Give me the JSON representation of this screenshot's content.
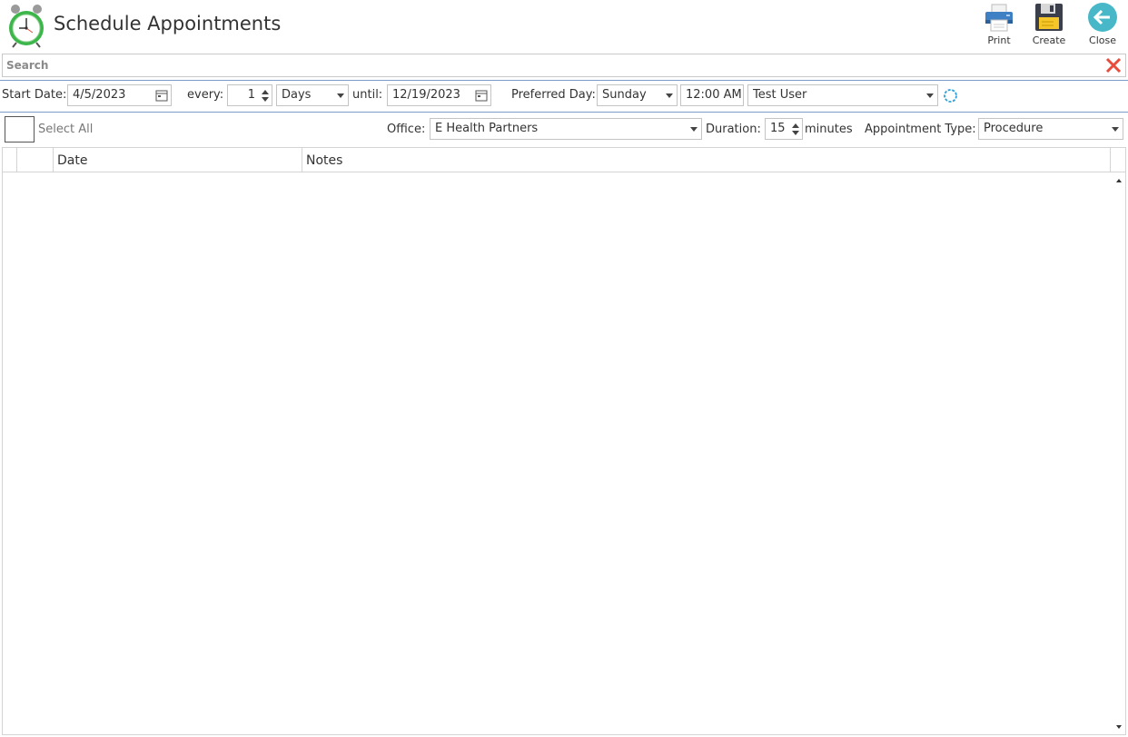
{
  "window": {
    "title": "Schedule Appointments",
    "app_icon": "alarm-clock-icon"
  },
  "toolbar": {
    "print_label": "Print",
    "create_label": "Create",
    "close_label": "Close"
  },
  "search": {
    "placeholder": "Search",
    "value": ""
  },
  "schedule": {
    "start_date_label": "Start Date:",
    "start_date": "4/5/2023",
    "every_label": "every:",
    "every_value": "1",
    "interval_unit": "Days",
    "until_label": "until:",
    "until_date": "12/19/2023",
    "preferred_day_label": "Preferred Day:",
    "preferred_day": "Sunday",
    "time": "12:00 AM",
    "user": "Test User"
  },
  "options": {
    "select_all_label": "Select All",
    "office_label": "Office:",
    "office": "E Health Partners",
    "duration_label": "Duration:",
    "duration_value": "15",
    "duration_unit": "minutes",
    "appointment_type_label": "Appointment Type:",
    "appointment_type": "Procedure"
  },
  "grid": {
    "columns": [
      "",
      "",
      "Date",
      "Notes"
    ],
    "rows": []
  },
  "colors": {
    "accent_rule": "#7b9cc8",
    "close_red": "#e74c3c",
    "refresh_blue": "#2e9fd8",
    "close_button_teal": "#48b8c9"
  }
}
